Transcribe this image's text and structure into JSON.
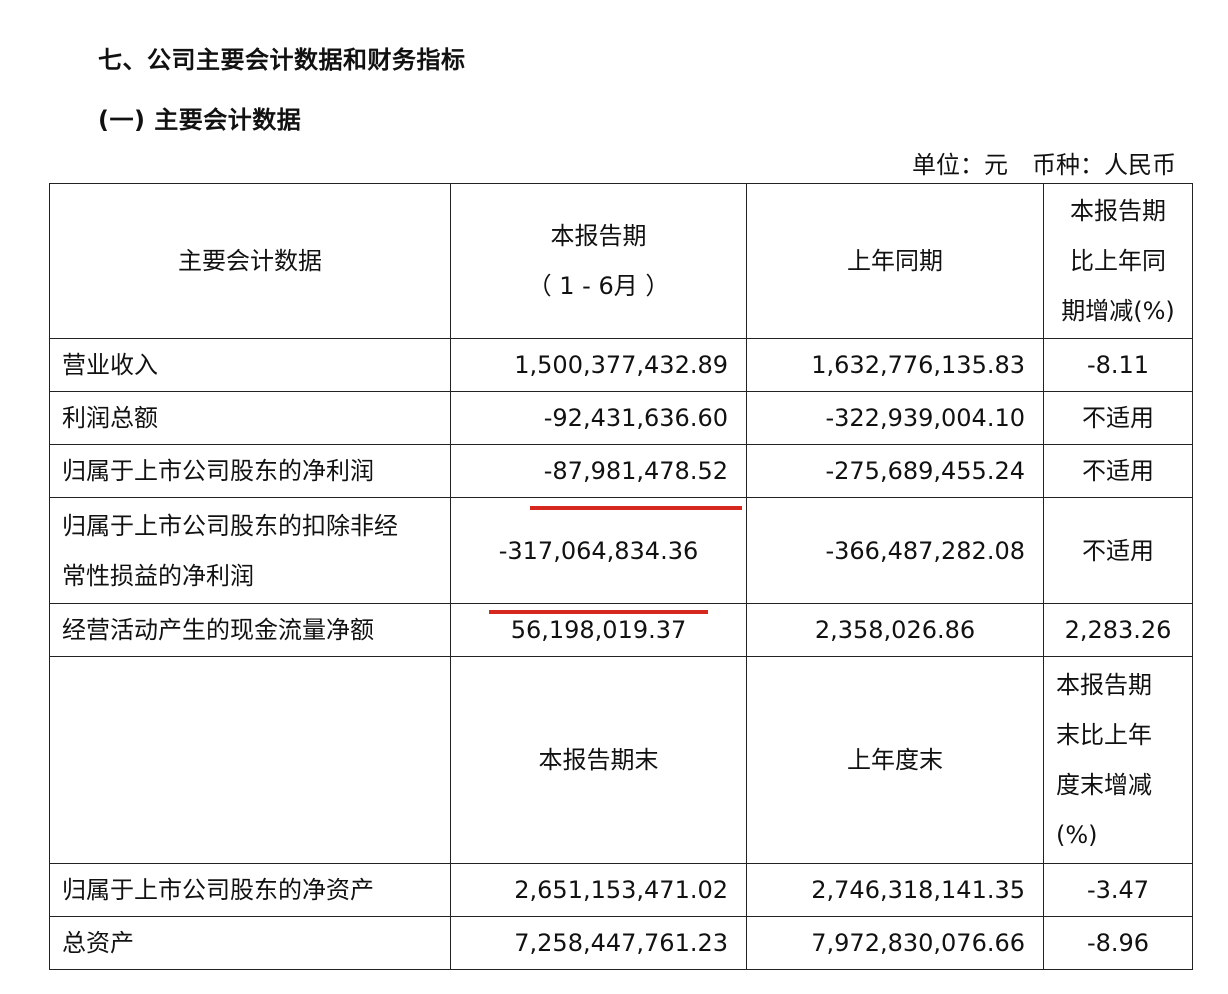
{
  "heading": "七、公司主要会计数据和财务指标",
  "subheading": "(一) 主要会计数据",
  "unit_note": "单位：元　币种：人民币",
  "header1": {
    "col0": "主要会计数据",
    "col1_line1": "本报告期",
    "col1_line2": "（ 1 - 6月 ）",
    "col2": "上年同期",
    "col3_lines": [
      "本报告期",
      "比上年同",
      "期增减(%)"
    ]
  },
  "rows1": [
    {
      "label": "营业收入",
      "current": "1,500,377,432.89",
      "prior": "1,632,776,135.83",
      "change": "-8.11"
    },
    {
      "label": "利润总额",
      "current": "-92,431,636.60",
      "prior": "-322,939,004.10",
      "change": "不适用"
    },
    {
      "label": "归属于上市公司股东的净利润",
      "current": "-87,981,478.52",
      "prior": "-275,689,455.24",
      "change": "不适用"
    },
    {
      "label_lines": [
        "归属于上市公司股东的扣除非经",
        "常性损益的净利润"
      ],
      "current": "-317,064,834.36",
      "prior": "-366,487,282.08",
      "change": "不适用"
    },
    {
      "label": "经营活动产生的现金流量净额",
      "current": "56,198,019.37",
      "prior": "2,358,026.86",
      "change": "2,283.26"
    }
  ],
  "header2": {
    "col0": "",
    "col1": "本报告期末",
    "col2": "上年度末",
    "col3_lines": [
      "本报告期",
      "末比上年",
      "度末增减",
      "(%)"
    ]
  },
  "rows2": [
    {
      "label": "归属于上市公司股东的净资产",
      "current": "2,651,153,471.02",
      "prior": "2,746,318,141.35",
      "change": "-3.47"
    },
    {
      "label": "总资产",
      "current": "7,258,447,761.23",
      "prior": "7,972,830,076.66",
      "change": "-8.96"
    }
  ],
  "highlight_color": "#d7281f"
}
